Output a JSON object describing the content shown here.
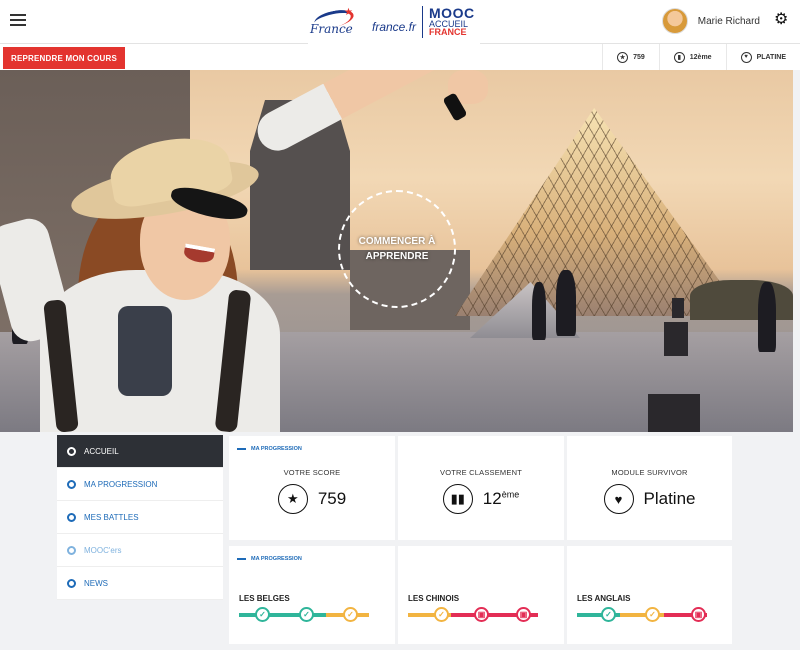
{
  "header": {
    "logo_word": "France",
    "logo_site": "france.fr",
    "logo_mooc": "MOOC",
    "logo_accueil": "ACCUEIL",
    "logo_france": "FRANCE",
    "user_name": "Marie Richard"
  },
  "subbar": {
    "resume_label": "REPRENDRE MON COURS",
    "stats": [
      {
        "icon": "star-icon",
        "value": "759"
      },
      {
        "icon": "ranking-icon",
        "value": "12ème"
      },
      {
        "icon": "heart-icon",
        "value": "PLATINE"
      }
    ]
  },
  "hero": {
    "cta": "COMMENCER À APPRENDRE"
  },
  "sidebar": {
    "items": [
      {
        "label": "ACCUEIL"
      },
      {
        "label": "MA PROGRESSION"
      },
      {
        "label": "MES BATTLES"
      },
      {
        "label": "MOOC'ers"
      },
      {
        "label": "NEWS"
      }
    ]
  },
  "progress": {
    "section_title": "MA PROGRESSION",
    "cards": [
      {
        "label": "VOTRE SCORE",
        "value": "759",
        "icon": "star-icon"
      },
      {
        "label": "VOTRE CLASSEMENT",
        "value": "12",
        "suffix": "ème",
        "icon": "bar-chart-icon"
      },
      {
        "label": "MODULE SURVIVOR",
        "value": "Platine",
        "icon": "heart-icon"
      }
    ]
  },
  "battles": {
    "section_title": "MA PROGRESSION",
    "teams": [
      {
        "name": "LES BELGES",
        "states": [
          "done",
          "done",
          "pending"
        ]
      },
      {
        "name": "LES CHINOIS",
        "states": [
          "pending",
          "locked",
          "locked"
        ]
      },
      {
        "name": "LES ANGLAIS",
        "states": [
          "done",
          "pending",
          "locked"
        ]
      }
    ]
  },
  "colors": {
    "accent_red": "#e3342f",
    "brand_blue": "#1a3a8a",
    "link_blue": "#1e6bb8",
    "done": "#2fb59a",
    "pending": "#f2b441",
    "locked": "#e32d55"
  }
}
